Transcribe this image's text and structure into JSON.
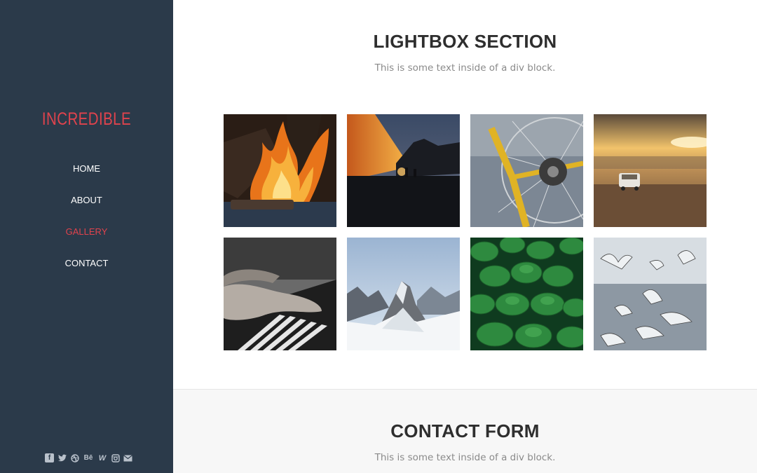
{
  "brand": "INCREDIBLE",
  "nav": [
    {
      "label": "HOME",
      "active": false
    },
    {
      "label": "ABOUT",
      "active": false
    },
    {
      "label": "GALLERY",
      "active": true
    },
    {
      "label": "CONTACT",
      "active": false
    }
  ],
  "social": [
    "facebook-icon",
    "twitter-icon",
    "dribbble-icon",
    "behance-icon",
    "webflow-icon",
    "instagram-icon",
    "mail-icon"
  ],
  "lightbox": {
    "title": "LIGHTBOX SECTION",
    "subtitle": "This is some text inside of a div block."
  },
  "gallery": [
    "campfire-photo",
    "silhouette-photo",
    "bicycle-photo",
    "desert-car-photo",
    "piano-photo",
    "snowy-mountain-photo",
    "lily-pads-photo",
    "seagulls-photo"
  ],
  "contact": {
    "title": "CONTACT FORM",
    "subtitle": "This is some text inside of a div block."
  },
  "colors": {
    "sidebar": "#2b3a4a",
    "accent": "#e0434d"
  }
}
